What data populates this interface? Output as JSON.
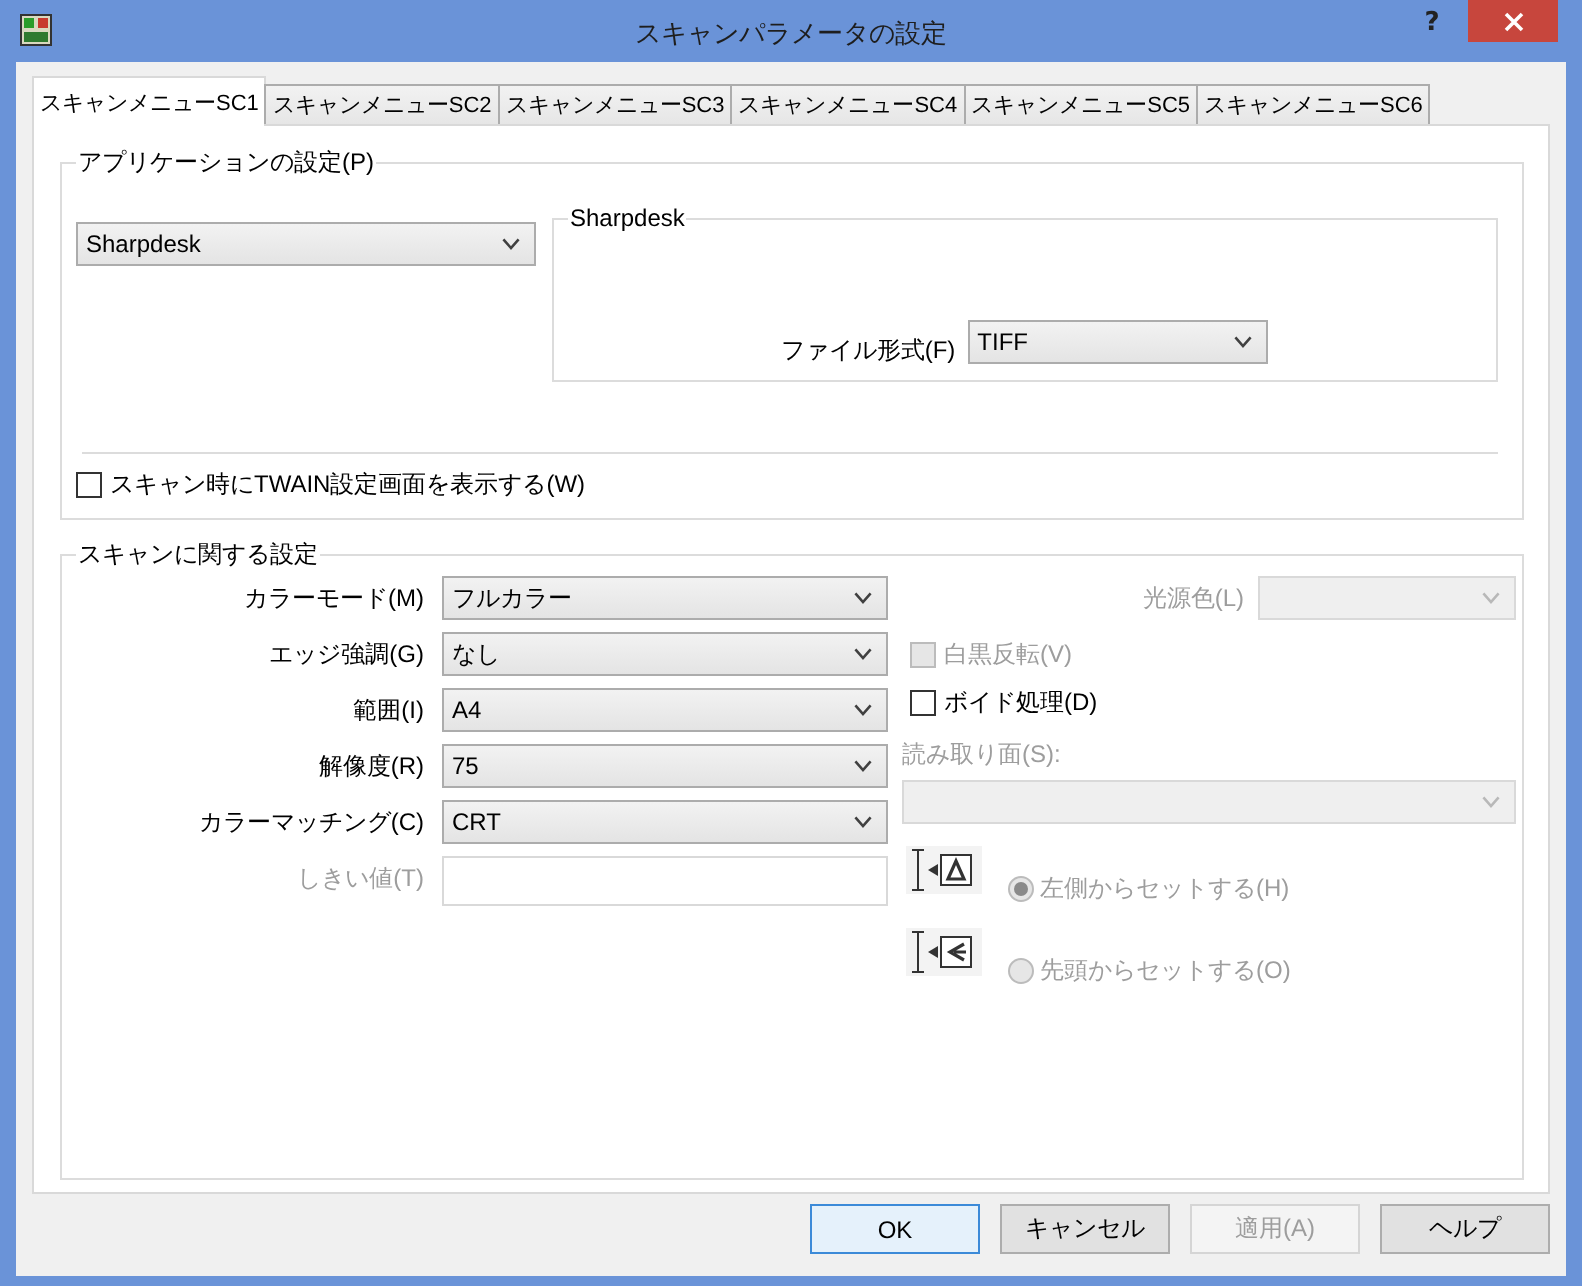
{
  "window": {
    "title": "スキャンパラメータの設定",
    "help_button": "?"
  },
  "tabs": [
    {
      "label": "スキャンメニューSC1",
      "selected": true
    },
    {
      "label": "スキャンメニューSC2",
      "selected": false
    },
    {
      "label": "スキャンメニューSC3",
      "selected": false
    },
    {
      "label": "スキャンメニューSC4",
      "selected": false
    },
    {
      "label": "スキャンメニューSC5",
      "selected": false
    },
    {
      "label": "スキャンメニューSC6",
      "selected": false
    }
  ],
  "application_settings": {
    "title": "アプリケーションの設定(P)",
    "application": {
      "value": "Sharpdesk"
    },
    "application_group": {
      "title": "Sharpdesk",
      "file_format": {
        "label": "ファイル形式(F)",
        "value": "TIFF"
      }
    },
    "show_twain_dialog": {
      "label": "スキャン時にTWAIN設定画面を表示する(W)",
      "checked": false
    }
  },
  "scan_settings": {
    "title": "スキャンに関する設定",
    "fields": [
      {
        "kind": "select",
        "label": "カラーモード(M)",
        "value": "フルカラー",
        "disabled": false
      },
      {
        "kind": "select",
        "label": "エッジ強調(G)",
        "value": "なし",
        "disabled": false
      },
      {
        "kind": "select",
        "label": "範囲(I)",
        "value": "A4",
        "disabled": false
      },
      {
        "kind": "select",
        "label": "解像度(R)",
        "value": "75",
        "disabled": false
      },
      {
        "kind": "select",
        "label": "カラーマッチング(C)",
        "value": "CRT",
        "disabled": false
      },
      {
        "kind": "text",
        "label": "しきい値(T)",
        "disabled": true
      }
    ],
    "light_source": {
      "label": "光源色(L)",
      "disabled": true
    },
    "options": [
      {
        "label": "白黒反転(V)",
        "checked": false,
        "disabled": true
      },
      {
        "label": "ボイド処理(D)",
        "checked": false,
        "disabled": false
      }
    ],
    "scan_side": {
      "label": "読み取り面(S):",
      "disabled": true
    },
    "feed_direction": [
      {
        "kind": "side",
        "label": "左側からセットする(H)",
        "selected": true,
        "disabled": true
      },
      {
        "kind": "head",
        "label": "先頭からセットする(O)",
        "selected": false,
        "disabled": true
      }
    ]
  },
  "buttons": [
    {
      "label": "OK",
      "kind": "default",
      "disabled": false
    },
    {
      "label": "キャンセル",
      "kind": "normal",
      "disabled": false
    },
    {
      "label": "適用(A)",
      "kind": "normal",
      "disabled": true
    },
    {
      "label": "ヘルプ",
      "kind": "normal",
      "disabled": false
    }
  ]
}
